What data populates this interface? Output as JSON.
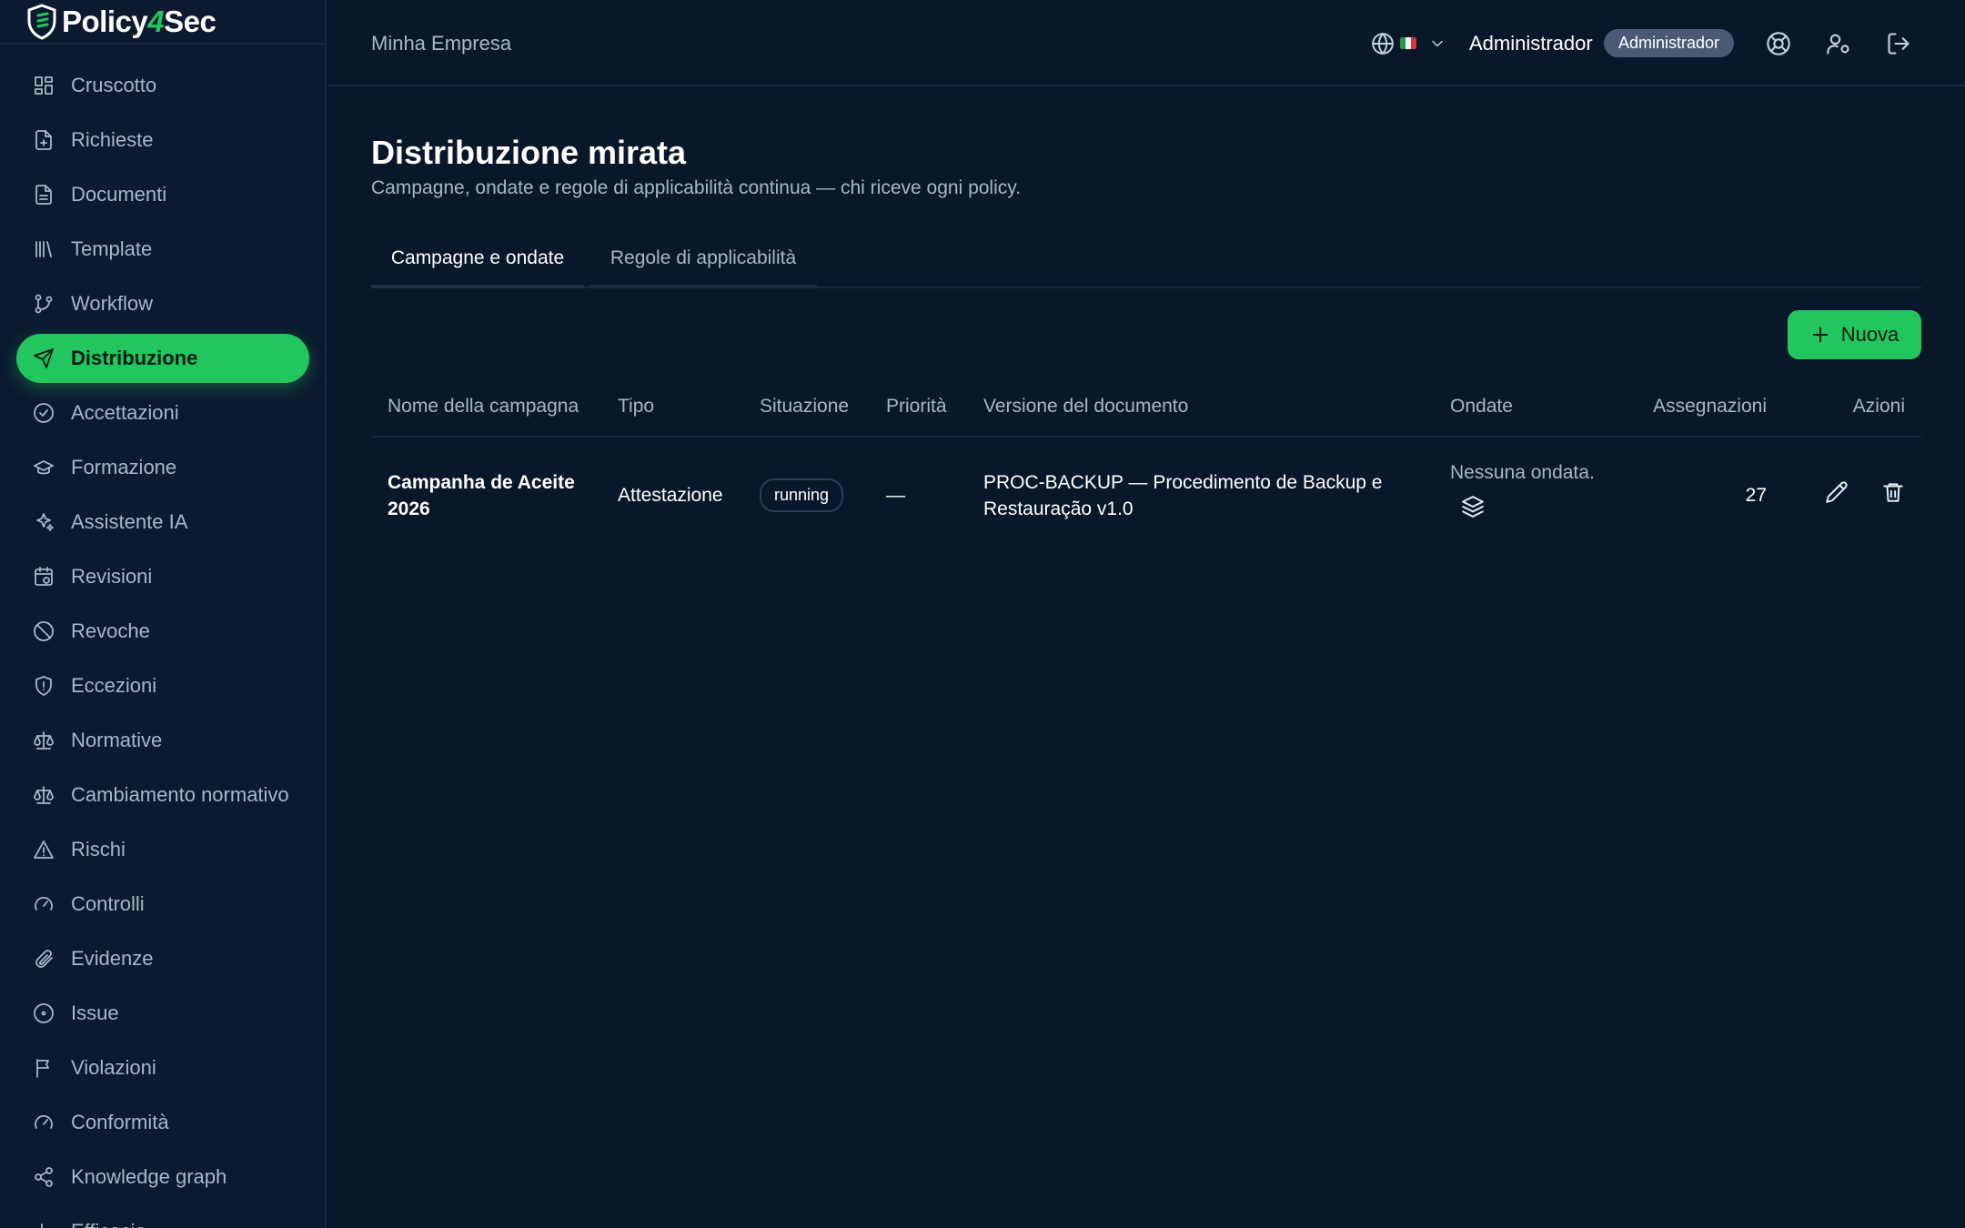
{
  "brand": {
    "name_a": "Policy",
    "name_b": "4",
    "name_c": "Sec",
    "accent": "#22c55e"
  },
  "sidebar": {
    "items": [
      {
        "label": "Cruscotto",
        "icon": "dashboard-icon"
      },
      {
        "label": "Richieste",
        "icon": "file-plus-icon"
      },
      {
        "label": "Documenti",
        "icon": "document-icon"
      },
      {
        "label": "Template",
        "icon": "library-icon"
      },
      {
        "label": "Workflow",
        "icon": "git-branch-icon"
      },
      {
        "label": "Distribuzione",
        "icon": "send-icon",
        "active": true
      },
      {
        "label": "Accettazioni",
        "icon": "check-circle-icon"
      },
      {
        "label": "Formazione",
        "icon": "graduation-cap-icon"
      },
      {
        "label": "Assistente IA",
        "icon": "sparkles-icon"
      },
      {
        "label": "Revisioni",
        "icon": "calendar-clock-icon"
      },
      {
        "label": "Revoche",
        "icon": "ban-icon"
      },
      {
        "label": "Eccezioni",
        "icon": "shield-alert-icon"
      },
      {
        "label": "Normative",
        "icon": "scale-icon"
      },
      {
        "label": "Cambiamento normativo",
        "icon": "scale-icon"
      },
      {
        "label": "Rischi",
        "icon": "warning-icon"
      },
      {
        "label": "Controlli",
        "icon": "gauge-icon"
      },
      {
        "label": "Evidenze",
        "icon": "paperclip-icon"
      },
      {
        "label": "Issue",
        "icon": "circle-dot-icon"
      },
      {
        "label": "Violazioni",
        "icon": "flag-icon"
      },
      {
        "label": "Conformità",
        "icon": "gauge-icon"
      },
      {
        "label": "Knowledge graph",
        "icon": "share-icon"
      },
      {
        "label": "Efficacia",
        "icon": "chart-icon"
      }
    ]
  },
  "header": {
    "company": "Minha Empresa",
    "user_name": "Administrador",
    "role_badge": "Administrador",
    "language_flag": "it"
  },
  "page": {
    "title": "Distribuzione mirata",
    "subtitle": "Campagne, ondate e regole di applicabilità continua — chi riceve ogni policy.",
    "tabs": [
      {
        "label": "Campagne e ondate",
        "active": true
      },
      {
        "label": "Regole di applicabilità",
        "active": false
      }
    ],
    "new_button": "Nuova"
  },
  "table": {
    "columns": {
      "name": "Nome della campagna",
      "type": "Tipo",
      "status": "Situazione",
      "priority": "Priorità",
      "doc_version": "Versione del documento",
      "waves": "Ondate",
      "assignments": "Assegnazioni",
      "actions": "Azioni"
    },
    "rows": [
      {
        "name": "Campanha de Aceite 2026",
        "type": "Attestazione",
        "status": "running",
        "priority": "—",
        "doc_version": "PROC-BACKUP — Procedimento de Backup e Restauração v1.0",
        "waves": "Nessuna ondata.",
        "assignments": "27"
      }
    ]
  }
}
